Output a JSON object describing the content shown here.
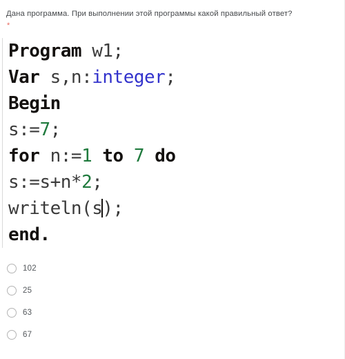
{
  "question": {
    "text": "Дана программа. При выполнении этой программы какой правильный ответ?",
    "required_marker": "*",
    "required_color": "#e8695f"
  },
  "code": {
    "language": "pascal",
    "colors": {
      "keyword": "#14110f",
      "identifier": "#3b3b3b",
      "type": "#3333cc",
      "number": "#1f7a3d"
    },
    "lines": [
      {
        "id": "line-program",
        "tokens": [
          {
            "text": "Program",
            "kind": "keyword"
          },
          {
            "text": " w1;",
            "kind": "plain"
          }
        ]
      },
      {
        "id": "line-var",
        "tokens": [
          {
            "text": "Var",
            "kind": "keyword"
          },
          {
            "text": " s,n:",
            "kind": "plain"
          },
          {
            "text": "integer",
            "kind": "type"
          },
          {
            "text": ";",
            "kind": "plain"
          }
        ]
      },
      {
        "id": "line-begin",
        "tokens": [
          {
            "text": "Begin",
            "kind": "keyword"
          }
        ]
      },
      {
        "id": "line-assign-s",
        "tokens": [
          {
            "text": "s:=",
            "kind": "plain"
          },
          {
            "text": "7",
            "kind": "number"
          },
          {
            "text": ";",
            "kind": "plain"
          }
        ]
      },
      {
        "id": "line-for",
        "tokens": [
          {
            "text": "for",
            "kind": "keyword"
          },
          {
            "text": " n:=",
            "kind": "plain"
          },
          {
            "text": "1",
            "kind": "number"
          },
          {
            "text": " ",
            "kind": "plain"
          },
          {
            "text": "to",
            "kind": "keyword"
          },
          {
            "text": " ",
            "kind": "plain"
          },
          {
            "text": "7",
            "kind": "number"
          },
          {
            "text": " ",
            "kind": "plain"
          },
          {
            "text": "do",
            "kind": "keyword"
          }
        ]
      },
      {
        "id": "line-sum",
        "tokens": [
          {
            "text": "s:=s+n*",
            "kind": "plain"
          },
          {
            "text": "2",
            "kind": "number"
          },
          {
            "text": ";",
            "kind": "plain"
          }
        ]
      },
      {
        "id": "line-writeln",
        "tokens": [
          {
            "text": "writeln(s",
            "kind": "plain"
          },
          {
            "text": "",
            "kind": "caret"
          },
          {
            "text": ");",
            "kind": "plain"
          }
        ]
      },
      {
        "id": "line-end",
        "tokens": [
          {
            "text": "end.",
            "kind": "keyword"
          }
        ]
      }
    ]
  },
  "answers": {
    "selected": null,
    "options": [
      {
        "id": "option-102",
        "label": "102",
        "checked": false
      },
      {
        "id": "option-25",
        "label": "25",
        "checked": false
      },
      {
        "id": "option-63",
        "label": "63",
        "checked": false
      },
      {
        "id": "option-67",
        "label": "67",
        "checked": false
      }
    ]
  }
}
